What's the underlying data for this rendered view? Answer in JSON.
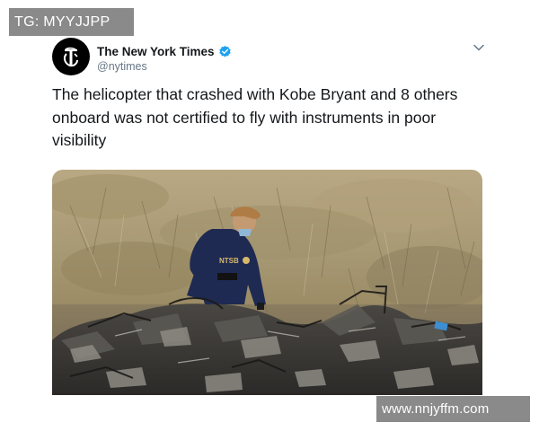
{
  "watermarks": {
    "top": "TG: MYYJJPP",
    "bottom": "www.nnjyffm.com"
  },
  "tweet": {
    "account_name": "The New York Times",
    "handle": "@nytimes",
    "verified": true,
    "avatar_icon": "nyt-logo-icon",
    "menu_icon": "chevron-down-icon",
    "text": "The helicopter that crashed with Kobe Bryant and 8 others onboard was not certified to fly with instruments in poor visibility",
    "image_vest_text": "NTSB"
  },
  "colors": {
    "verified_blue": "#1da1f2",
    "text_primary": "#14171a",
    "text_secondary": "#657786",
    "watermark_bg": "#8a8a8a"
  }
}
